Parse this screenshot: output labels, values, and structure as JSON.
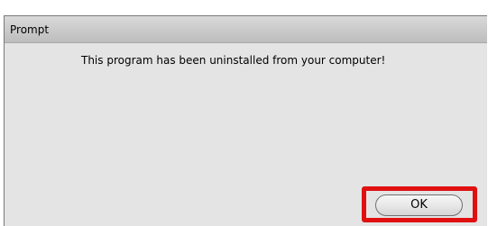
{
  "dialog": {
    "title": "Prompt",
    "message": "This program has been uninstalled from your computer!",
    "ok_label": "OK"
  },
  "colors": {
    "highlight": "#e01010",
    "body_background": "#e4e4e4"
  }
}
